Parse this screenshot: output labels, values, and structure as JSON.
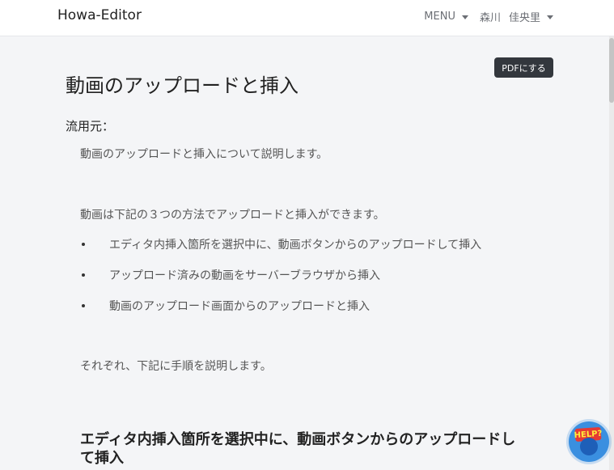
{
  "navbar": {
    "brand": "Howa-Editor",
    "menu_label": "MENU",
    "user_last": "森川",
    "user_first": "佳央里"
  },
  "toolbar": {
    "pdf_label": "PDFにする"
  },
  "article": {
    "title": "動画のアップロードと挿入",
    "source_label": "流用元：",
    "intro": "動画のアップロードと挿入について説明します。",
    "methods_intro": "動画は下記の３つの方法でアップロードと挿入ができます。",
    "methods": [
      "エディタ内挿入箇所を選択中に、動画ボタンからのアップロードして挿入",
      "アップロード済みの動画をサーバーブラウザから挿入",
      "動画のアップロード画面からのアップロードと挿入"
    ],
    "outro": "それぞれ、下記に手順を説明します。",
    "section_heading": "エディタ内挿入箇所を選択中に、動画ボタンからのアップロードして挿入"
  },
  "help": {
    "label": "HELP?"
  }
}
